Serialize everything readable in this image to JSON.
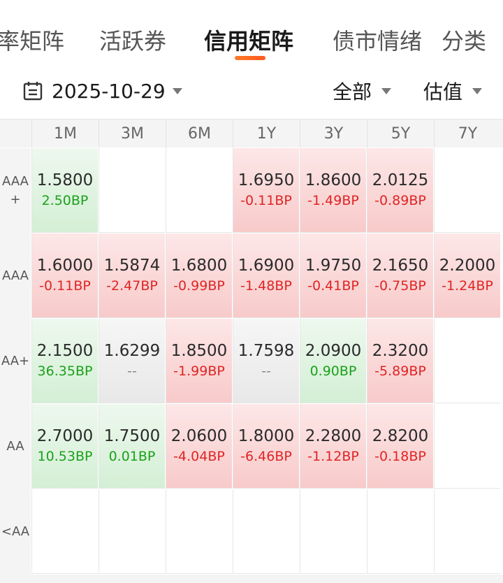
{
  "tabs": [
    {
      "label": "率矩阵",
      "active": false
    },
    {
      "label": "活跃券",
      "active": false
    },
    {
      "label": "信用矩阵",
      "active": true
    },
    {
      "label": "债市情绪",
      "active": false
    },
    {
      "label": "分类",
      "active": false
    }
  ],
  "filters": {
    "date": "2025-10-29",
    "scope": "全部",
    "metric": "估值"
  },
  "matrix": {
    "columns": [
      "1M",
      "3M",
      "6M",
      "1Y",
      "3Y",
      "5Y",
      "7Y"
    ],
    "rows": [
      {
        "label": "AAA+",
        "cells": [
          {
            "value": "1.5800",
            "change": "2.50BP",
            "tone": "green"
          },
          {
            "value": "",
            "change": "",
            "tone": "empty"
          },
          {
            "value": "",
            "change": "",
            "tone": "empty"
          },
          {
            "value": "1.6950",
            "change": "-0.11BP",
            "tone": "red"
          },
          {
            "value": "1.8600",
            "change": "-1.49BP",
            "tone": "red"
          },
          {
            "value": "2.0125",
            "change": "-0.89BP",
            "tone": "red"
          },
          {
            "value": "",
            "change": "",
            "tone": "empty"
          }
        ]
      },
      {
        "label": "AAA",
        "cells": [
          {
            "value": "1.6000",
            "change": "-0.11BP",
            "tone": "red"
          },
          {
            "value": "1.5874",
            "change": "-2.47BP",
            "tone": "red"
          },
          {
            "value": "1.6800",
            "change": "-0.99BP",
            "tone": "red"
          },
          {
            "value": "1.6900",
            "change": "-1.48BP",
            "tone": "red"
          },
          {
            "value": "1.9750",
            "change": "-0.41BP",
            "tone": "red"
          },
          {
            "value": "2.1650",
            "change": "-0.75BP",
            "tone": "red"
          },
          {
            "value": "2.2000",
            "change": "-1.24BP",
            "tone": "red"
          }
        ]
      },
      {
        "label": "AA+",
        "cells": [
          {
            "value": "2.1500",
            "change": "36.35BP",
            "tone": "green"
          },
          {
            "value": "1.6299",
            "change": "--",
            "tone": "gray"
          },
          {
            "value": "1.8500",
            "change": "-1.99BP",
            "tone": "red"
          },
          {
            "value": "1.7598",
            "change": "--",
            "tone": "gray"
          },
          {
            "value": "2.0900",
            "change": "0.90BP",
            "tone": "green"
          },
          {
            "value": "2.3200",
            "change": "-5.89BP",
            "tone": "red"
          },
          {
            "value": "",
            "change": "",
            "tone": "empty"
          }
        ]
      },
      {
        "label": "AA",
        "cells": [
          {
            "value": "2.7000",
            "change": "10.53BP",
            "tone": "green"
          },
          {
            "value": "1.7500",
            "change": "0.01BP",
            "tone": "green"
          },
          {
            "value": "2.0600",
            "change": "-4.04BP",
            "tone": "red"
          },
          {
            "value": "1.8000",
            "change": "-6.46BP",
            "tone": "red"
          },
          {
            "value": "2.2800",
            "change": "-1.12BP",
            "tone": "red"
          },
          {
            "value": "2.8200",
            "change": "-0.18BP",
            "tone": "red"
          },
          {
            "value": "",
            "change": "",
            "tone": "empty"
          }
        ]
      },
      {
        "label": "<AA",
        "cells": [
          {
            "value": "",
            "change": "",
            "tone": "empty"
          },
          {
            "value": "",
            "change": "",
            "tone": "empty"
          },
          {
            "value": "",
            "change": "",
            "tone": "empty"
          },
          {
            "value": "",
            "change": "",
            "tone": "empty"
          },
          {
            "value": "",
            "change": "",
            "tone": "empty"
          },
          {
            "value": "",
            "change": "",
            "tone": "empty"
          },
          {
            "value": "",
            "change": "",
            "tone": "empty"
          }
        ]
      }
    ]
  },
  "colors": {
    "accent": "#ff5a1f",
    "up_red": "#e02424",
    "down_green": "#1aa11a"
  }
}
